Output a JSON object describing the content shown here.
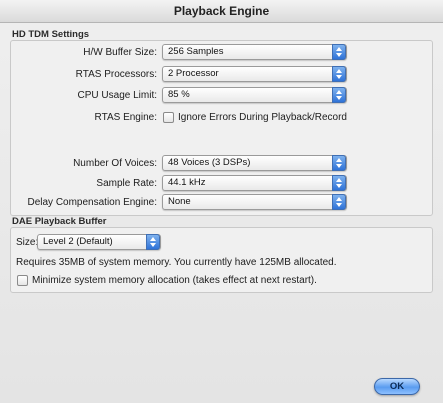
{
  "window": {
    "title": "Playback Engine"
  },
  "tdm": {
    "section_label": "HD TDM Settings",
    "hw_buffer": {
      "label": "H/W Buffer Size:",
      "value": "256 Samples"
    },
    "rtas_processors": {
      "label": "RTAS Processors:",
      "value": "2 Processor"
    },
    "cpu_usage": {
      "label": "CPU Usage Limit:",
      "value": "85 %"
    },
    "rtas_engine": {
      "label": "RTAS Engine:",
      "checkbox_label": "Ignore Errors During Playback/Record",
      "checked": false
    },
    "voices": {
      "label": "Number Of Voices:",
      "value": "48 Voices (3 DSPs)"
    },
    "sample_rate": {
      "label": "Sample Rate:",
      "value": "44.1 kHz"
    },
    "delay_comp": {
      "label": "Delay Compensation Engine:",
      "value": "None"
    }
  },
  "dae": {
    "section_label": "DAE Playback Buffer",
    "size": {
      "label": "Size:",
      "value": "Level 2 (Default)"
    },
    "info": "Requires 35MB of system memory. You currently have 125MB allocated.",
    "minimize": {
      "label": "Minimize system memory allocation (takes effect at next restart).",
      "checked": false
    }
  },
  "buttons": {
    "ok": "OK"
  },
  "icons": {
    "popup_arrows": "up-down-arrows-icon"
  },
  "colors": {
    "accent": "#2f73d8",
    "ok_button": "#5a9cf0"
  }
}
